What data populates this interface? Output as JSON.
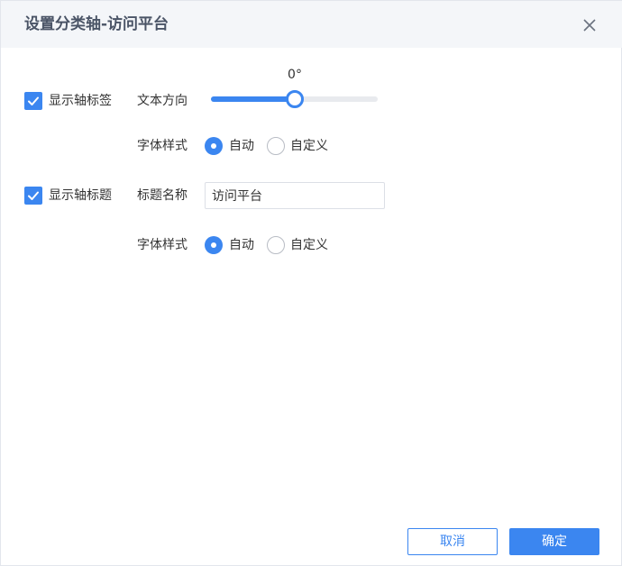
{
  "dialog": {
    "title": "设置分类轴-访问平台",
    "close_icon": "close-icon"
  },
  "axis_labels": {
    "show_label": "显示轴标签",
    "checked": true,
    "text_direction_label": "文本方向",
    "text_direction_value": "0°",
    "text_direction_slider_fraction": 0.5,
    "font_style_label": "字体样式",
    "font_style_options": [
      "自动",
      "自定义"
    ],
    "font_style_selected": "自动"
  },
  "axis_title": {
    "show_label": "显示轴标题",
    "checked": true,
    "title_name_label": "标题名称",
    "title_name_value": "访问平台",
    "font_style_label": "字体样式",
    "font_style_options": [
      "自动",
      "自定义"
    ],
    "font_style_selected": "自动"
  },
  "footer": {
    "cancel_label": "取消",
    "ok_label": "确定"
  },
  "colors": {
    "accent": "#3b86f0",
    "header_bg": "#f4f6f9",
    "title_text": "#4a5466"
  }
}
